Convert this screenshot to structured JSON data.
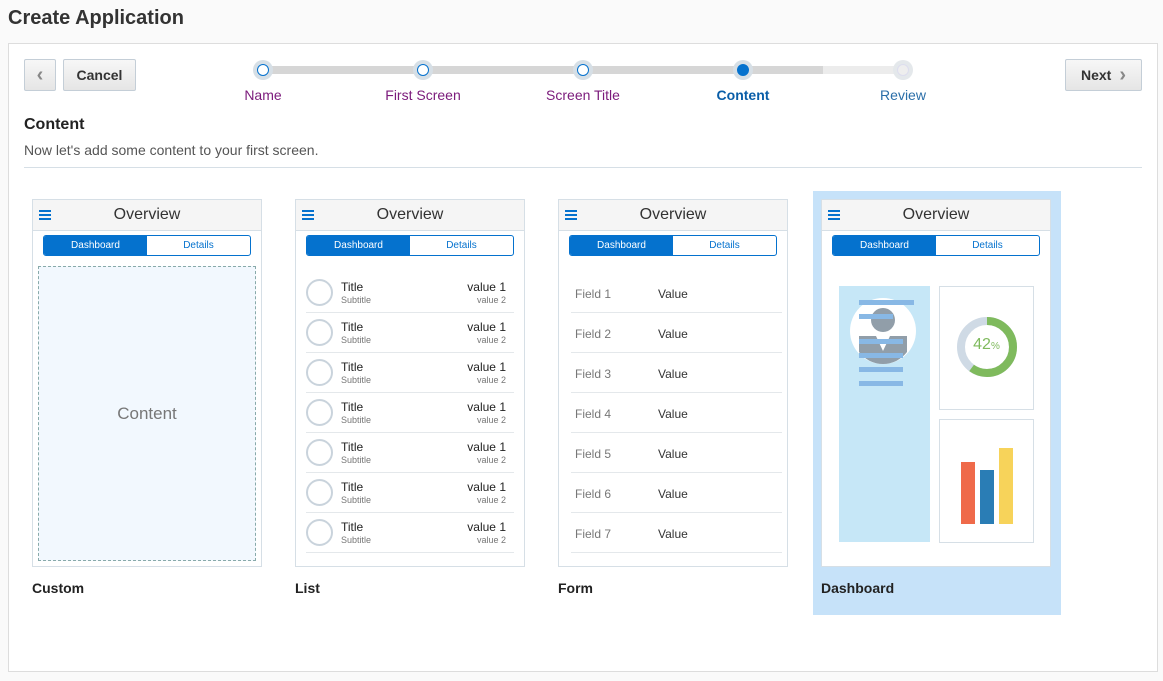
{
  "title": "Create Application",
  "toolbar": {
    "cancel": "Cancel",
    "next": "Next"
  },
  "steps": [
    {
      "label": "Name",
      "state": "done"
    },
    {
      "label": "First Screen",
      "state": "done"
    },
    {
      "label": "Screen Title",
      "state": "done"
    },
    {
      "label": "Content",
      "state": "current"
    },
    {
      "label": "Review",
      "state": "future"
    }
  ],
  "section": {
    "title": "Content",
    "description": "Now let's add some content to your first screen."
  },
  "cards": [
    {
      "label": "Custom",
      "header": "Overview",
      "tabs": [
        "Dashboard",
        "Details"
      ],
      "content": "Content"
    },
    {
      "label": "List",
      "header": "Overview",
      "tabs": [
        "Dashboard",
        "Details"
      ],
      "rows": [
        {
          "title": "Title",
          "subtitle": "Subtitle",
          "value1": "value 1",
          "value2": "value 2"
        },
        {
          "title": "Title",
          "subtitle": "Subtitle",
          "value1": "value 1",
          "value2": "value 2"
        },
        {
          "title": "Title",
          "subtitle": "Subtitle",
          "value1": "value 1",
          "value2": "value 2"
        },
        {
          "title": "Title",
          "subtitle": "Subtitle",
          "value1": "value 1",
          "value2": "value 2"
        },
        {
          "title": "Title",
          "subtitle": "Subtitle",
          "value1": "value 1",
          "value2": "value 2"
        },
        {
          "title": "Title",
          "subtitle": "Subtitle",
          "value1": "value 1",
          "value2": "value 2"
        },
        {
          "title": "Title",
          "subtitle": "Subtitle",
          "value1": "value 1",
          "value2": "value 2"
        }
      ]
    },
    {
      "label": "Form",
      "header": "Overview",
      "tabs": [
        "Dashboard",
        "Details"
      ],
      "fields": [
        {
          "field": "Field 1",
          "value": "Value"
        },
        {
          "field": "Field 2",
          "value": "Value"
        },
        {
          "field": "Field 3",
          "value": "Value"
        },
        {
          "field": "Field 4",
          "value": "Value"
        },
        {
          "field": "Field 5",
          "value": "Value"
        },
        {
          "field": "Field 6",
          "value": "Value"
        },
        {
          "field": "Field 7",
          "value": "Value"
        }
      ]
    },
    {
      "label": "Dashboard",
      "header": "Overview",
      "tabs": [
        "Dashboard",
        "Details"
      ],
      "gauge": {
        "value": "42",
        "unit": "%",
        "fraction": 0.42
      },
      "selected": true
    }
  ],
  "colors": {
    "accent": "#0572ce",
    "visited": "#7b1a7b",
    "selected": "#c6e2f9",
    "gauge": "#7fba5d",
    "bars": [
      "#ef6a4a",
      "#2a7db5",
      "#f7d35a"
    ]
  }
}
